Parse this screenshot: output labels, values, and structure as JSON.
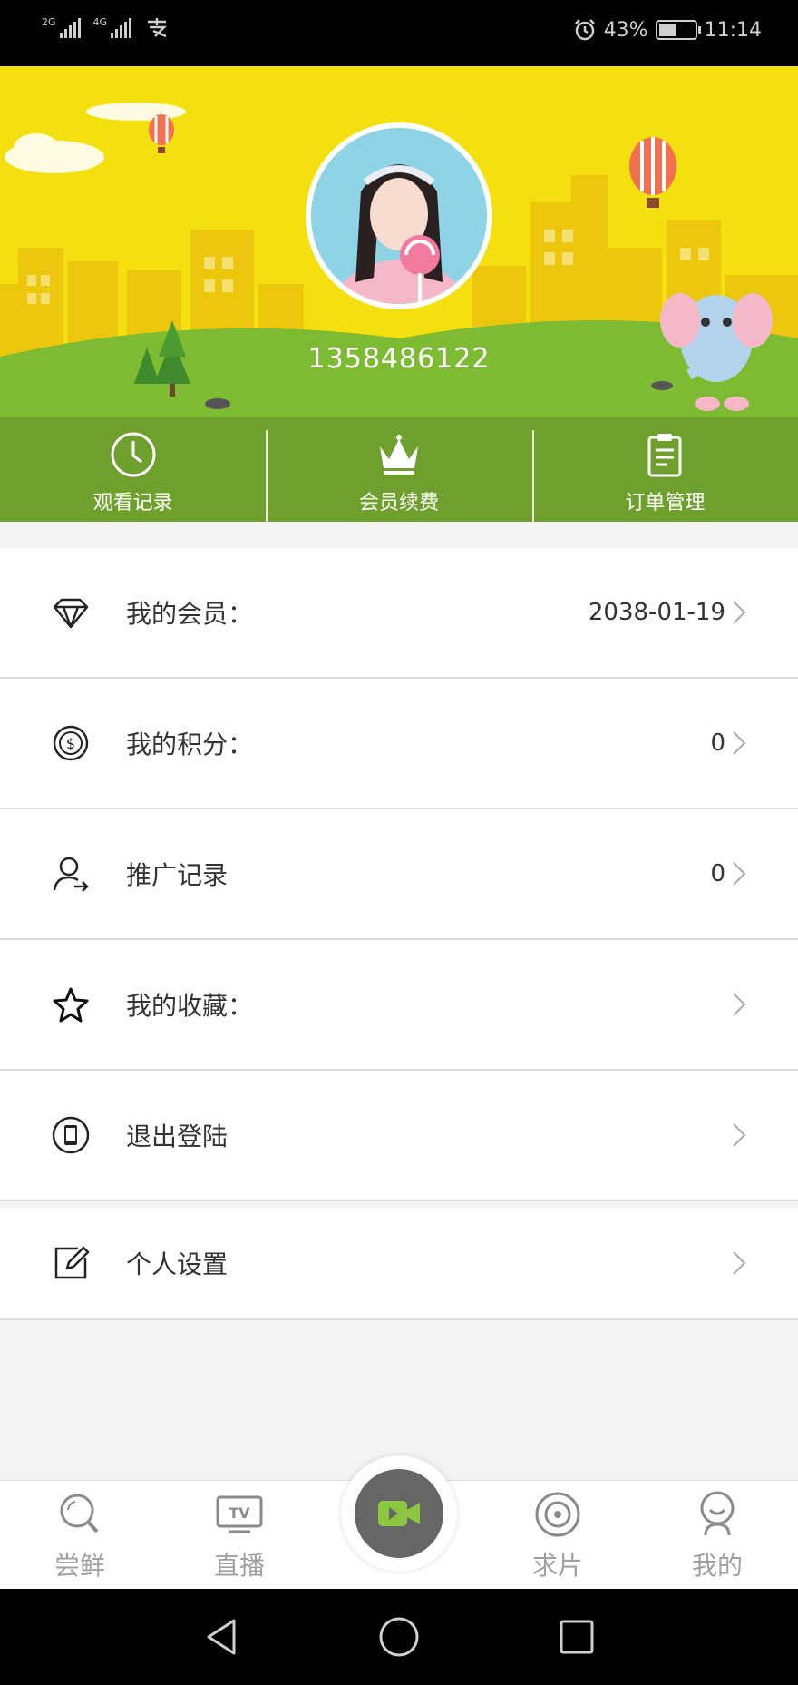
{
  "status_bar": {
    "network_1": "2G",
    "network_2": "4G",
    "carrier_icon": "alipay-icon",
    "battery": "43%",
    "battery_level": 0.43,
    "time": "11:14"
  },
  "profile": {
    "phone": "1358486122"
  },
  "quick_actions": [
    {
      "label": "观看记录",
      "icon": "clock-icon"
    },
    {
      "label": "会员续费",
      "icon": "crown-icon"
    },
    {
      "label": "订单管理",
      "icon": "clipboard-icon"
    }
  ],
  "menu": [
    {
      "label": "我的会员：",
      "value": "2038-01-19",
      "icon": "diamond-icon"
    },
    {
      "label": "我的积分：",
      "value": "0",
      "icon": "coin-icon"
    },
    {
      "label": "推广记录",
      "value": "0",
      "icon": "user-share-icon"
    },
    {
      "label": "我的收藏：",
      "value": "",
      "icon": "star-icon"
    },
    {
      "label": "退出登陆",
      "value": "",
      "icon": "logout-phone-icon"
    }
  ],
  "settings": {
    "label": "个人设置",
    "icon": "edit-icon"
  },
  "bottom_nav": [
    {
      "label": "尝鲜",
      "icon": "search-icon"
    },
    {
      "label": "直播",
      "icon": "tv-icon"
    },
    {
      "label": "",
      "icon": "video-camera-icon"
    },
    {
      "label": "求片",
      "icon": "target-icon"
    },
    {
      "label": "我的",
      "icon": "person-icon"
    }
  ],
  "colors": {
    "banner_yellow": "#f5e00f",
    "quick_bar_green": "#6fa02d",
    "center_button": "#666666",
    "camera_accent": "#8dc63f"
  }
}
